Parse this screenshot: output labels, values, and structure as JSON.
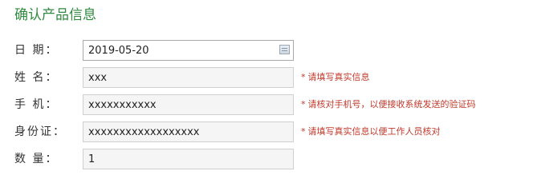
{
  "title": "确认产品信息",
  "fields": {
    "date": {
      "label": "日 期：",
      "value": "2019-05-20"
    },
    "name": {
      "label": "姓 名：",
      "value": "xxx",
      "hint_star": "*",
      "hint": "请填写真实信息"
    },
    "phone": {
      "label": "手 机：",
      "value": "xxxxxxxxxxx",
      "hint_star": "*",
      "hint": "请核对手机号，以便接收系统发送的验证码"
    },
    "id_card": {
      "label": "身份证：",
      "value": "xxxxxxxxxxxxxxxxxx",
      "hint_star": "*",
      "hint": "请填写真实信息以便工作人员核对"
    },
    "quantity": {
      "label": "数 量：",
      "value": "1"
    }
  },
  "icons": {
    "date_picker": "calendar-icon"
  },
  "colors": {
    "title": "#2f8a3f",
    "hint": "#c0392b",
    "field_background": "#f5f5f5",
    "field_border": "#cfcfcf"
  }
}
